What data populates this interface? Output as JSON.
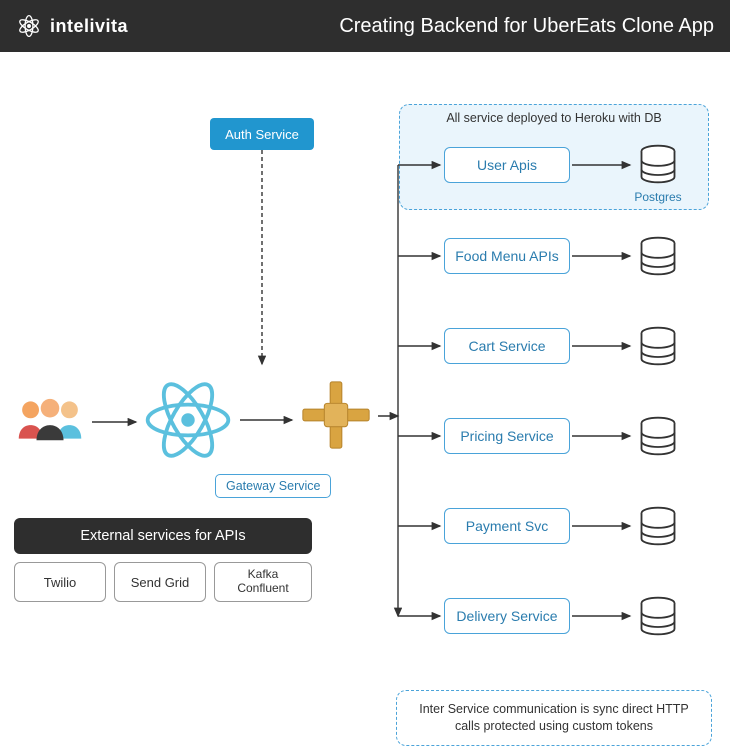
{
  "brand": "intelivita",
  "title": "Creating Backend for UberEats Clone App",
  "auth_service": "Auth Service",
  "heroku_note": "All service deployed to Heroku with DB",
  "postgres_label": "Postgres",
  "gateway_label": "Gateway Service",
  "services": {
    "user": "User Apis",
    "food": "Food Menu APIs",
    "cart": "Cart Service",
    "pricing": "Pricing Service",
    "payment": "Payment Svc",
    "delivery": "Delivery Service"
  },
  "external_title": "External services for APIs",
  "external": {
    "twilio": "Twilio",
    "sendgrid": "Send Grid",
    "kafka": "Kafka\nConfluent"
  },
  "footer": "Inter Service communication is sync direct HTTP calls protected using custom tokens"
}
